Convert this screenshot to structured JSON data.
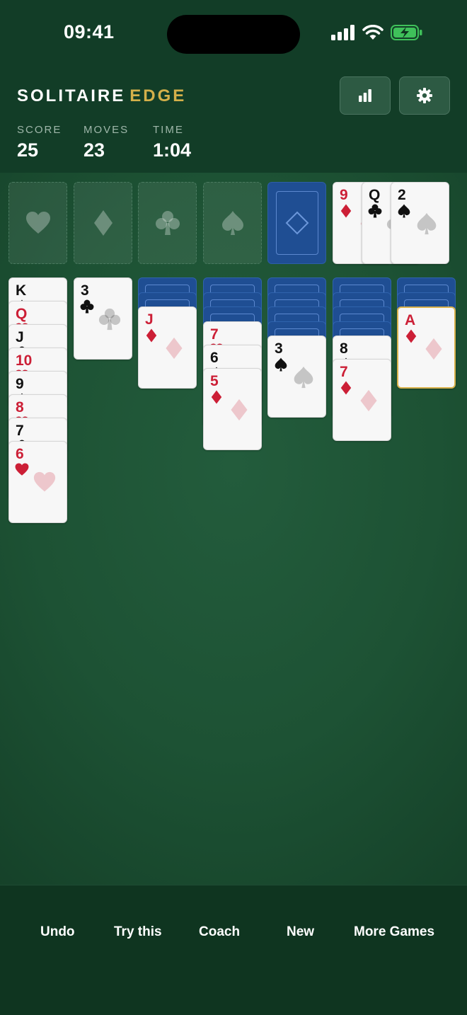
{
  "status_bar": {
    "time": "09:41"
  },
  "header": {
    "title_main": "SOLITAIRE",
    "title_accent": "EDGE",
    "stats": [
      {
        "label": "SCORE",
        "value": "25"
      },
      {
        "label": "MOVES",
        "value": "23"
      },
      {
        "label": "TIME",
        "value": "1:04"
      }
    ]
  },
  "foundations": [
    {
      "suit": "heart-icon"
    },
    {
      "suit": "diamond-icon"
    },
    {
      "suit": "club-icon"
    },
    {
      "suit": "spade-icon"
    }
  ],
  "waste": [
    {
      "rank": "9",
      "suit": "diamond"
    },
    {
      "rank": "Q",
      "suit": "club"
    },
    {
      "rank": "2",
      "suit": "spade"
    }
  ],
  "tableau": [
    {
      "face_down": 0,
      "face_up": [
        {
          "rank": "K",
          "suit": "spade"
        },
        {
          "rank": "Q",
          "suit": "heart"
        },
        {
          "rank": "J",
          "suit": "club"
        },
        {
          "rank": "10",
          "suit": "heart"
        },
        {
          "rank": "9",
          "suit": "spade"
        },
        {
          "rank": "8",
          "suit": "heart"
        },
        {
          "rank": "7",
          "suit": "club"
        },
        {
          "rank": "6",
          "suit": "heart"
        }
      ]
    },
    {
      "face_down": 0,
      "face_up": [
        {
          "rank": "3",
          "suit": "club"
        }
      ]
    },
    {
      "face_down": 2,
      "face_up": [
        {
          "rank": "J",
          "suit": "diamond"
        }
      ]
    },
    {
      "face_down": 3,
      "face_up": [
        {
          "rank": "7",
          "suit": "heart"
        },
        {
          "rank": "6",
          "suit": "spade"
        },
        {
          "rank": "5",
          "suit": "diamond"
        }
      ]
    },
    {
      "face_down": 4,
      "face_up": [
        {
          "rank": "3",
          "suit": "spade"
        }
      ]
    },
    {
      "face_down": 4,
      "face_up": [
        {
          "rank": "8",
          "suit": "spade"
        },
        {
          "rank": "7",
          "suit": "diamond"
        }
      ]
    },
    {
      "face_down": 2,
      "face_up": [
        {
          "rank": "A",
          "suit": "diamond",
          "highlighted": true
        }
      ]
    }
  ],
  "bottom_nav": [
    {
      "label": "Undo"
    },
    {
      "label": "Try this"
    },
    {
      "label": "Coach"
    },
    {
      "label": "New"
    },
    {
      "label": "More Games"
    }
  ],
  "colors": {
    "felt": "#1d5234",
    "card_red": "#cc1f36",
    "card_back": "#1f4e93",
    "accent_gold": "#d4b04a"
  }
}
